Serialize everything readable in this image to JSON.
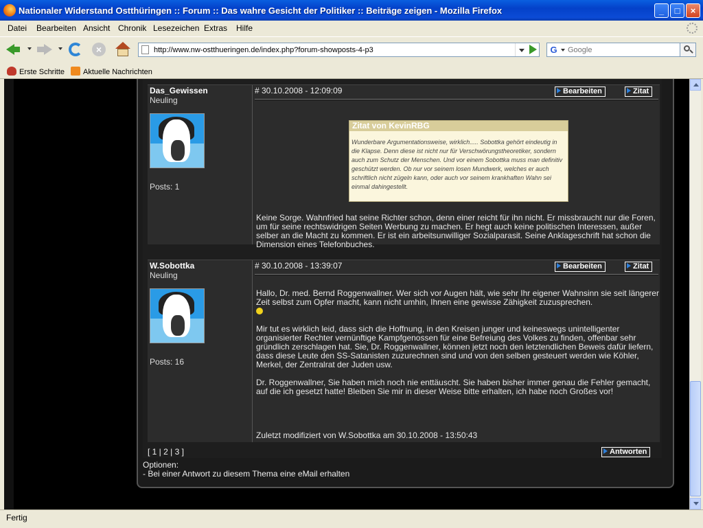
{
  "window": {
    "title": "Nationaler Widerstand Ostthüringen :: Forum :: Das wahre Gesicht der Politiker :: Beiträge zeigen - Mozilla Firefox"
  },
  "menu": [
    "Datei",
    "Bearbeiten",
    "Ansicht",
    "Chronik",
    "Lesezeichen",
    "Extras",
    "Hilfe"
  ],
  "nav": {
    "url": "http://www.nw-ostthueringen.de/index.php?forum-showposts-4-p3",
    "search_placeholder": "Google"
  },
  "bookmarks": [
    "Erste Schritte",
    "Aktuelle Nachrichten"
  ],
  "posts": [
    {
      "username": "Das_Gewissen",
      "rank": "Neuling",
      "posts_count": "Posts: 1",
      "meta": "# 30.10.2008 - 12:09:09",
      "edit_label": "Bearbeiten",
      "quote_label": "Zitat",
      "quote": {
        "header": "Zitat von KevinRBG",
        "text": "Wunderbare Argumentationsweise, wirklich..... Sobottka gehört eindeutig in die Klapse. Denn diese ist nicht nur für Verschwörungstheoretiker, sondern auch zum Schutz der Menschen. Und vor einem Sobottka muss man definitiv geschützt werden. Ob nur vor seinem losen Mundwerk, welches er auch schriftlich nicht zügeln kann, oder auch vor seinem krankhaften Wahn sei einmal dahingestellt."
      },
      "body": "Keine Sorge. Wahnfried hat seine Richter schon, denn einer reicht für ihn nicht. Er missbraucht nur die Foren, um für seine rechtswidrigen Seiten Werbung zu machen. Er hegt auch keine politischen Interessen, außer selber an die Macht zu kommen. Er ist ein arbeitsunwilliger Sozialparasit. Seine Anklageschrift hat schon die Dimension eines Telefonbuches."
    },
    {
      "username": "W.Sobottka",
      "rank": "Neuling",
      "posts_count": "Posts: 16",
      "meta": "# 30.10.2008 - 13:39:07",
      "edit_label": "Bearbeiten",
      "quote_label": "Zitat",
      "paragraphs": [
        "Hallo, Dr. med. Bernd Roggenwallner. Wer sich vor Augen hält, wie sehr Ihr eigener Wahnsinn sie seit längerer Zeit selbst zum Opfer macht, kann nicht umhin, Ihnen eine gewisse Zähigkeit zuzusprechen.",
        "Mir tut es wirklich leid, dass sich die Hoffnung, in den Kreisen junger und keineswegs unintelligenter organisierter Rechter vernünftige Kampfgenossen für eine Befreiung des Volkes zu finden, offenbar sehr gründlich zerschlagen hat. Sie, Dr. Roggenwallner, können jetzt noch den letztendlichen Beweis dafür liefern, dass diese Leute den SS-Satanisten zuzurechnen sind und von den selben gesteuert werden wie Köhler, Merkel, der Zentralrat der Juden usw.",
        "Dr. Roggenwallner, Sie haben mich noch nie enttäuscht. Sie haben bisher immer genau die Fehler gemacht, auf die ich gesetzt hatte! Bleiben Sie mir in dieser Weise bitte erhalten, ich habe noch Großes vor!"
      ],
      "edit_note": "Zuletzt modifiziert von W.Sobottka am 30.10.2008 - 13:50:43"
    }
  ],
  "footer": {
    "pagination": "[ 1 | 2 | 3 ]",
    "reply_label": "Antworten",
    "options_label": "Optionen:",
    "option_email": "- Bei einer Antwort zu diesem Thema eine eMail erhalten"
  },
  "status": "Fertig"
}
